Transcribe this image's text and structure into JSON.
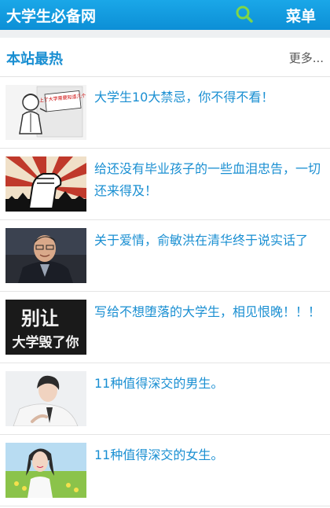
{
  "header": {
    "site_title": "大学生必备网",
    "menu_label": "菜单",
    "bar_color": "#0c8fd6",
    "search_icon": "search-icon"
  },
  "section": {
    "title": "本站最热",
    "more_label": "更多...",
    "accent_color": "#1a8fd2"
  },
  "articles": [
    {
      "title": "大学生10大禁忌，你不得不看！",
      "thumb_caption": "上了大学需要知道几个"
    },
    {
      "title": "给还没有毕业孩子的一些血泪忠告，一切还来得及！"
    },
    {
      "title": "关于爱情，俞敏洪在清华终于说实话了"
    },
    {
      "title": "写给不想堕落的大学生，相见恨晚！！！",
      "thumb_caption": [
        "别让",
        "大学毁了你"
      ]
    },
    {
      "title": "11种值得深交的男生。"
    },
    {
      "title": "11种值得深交的女生。"
    }
  ]
}
